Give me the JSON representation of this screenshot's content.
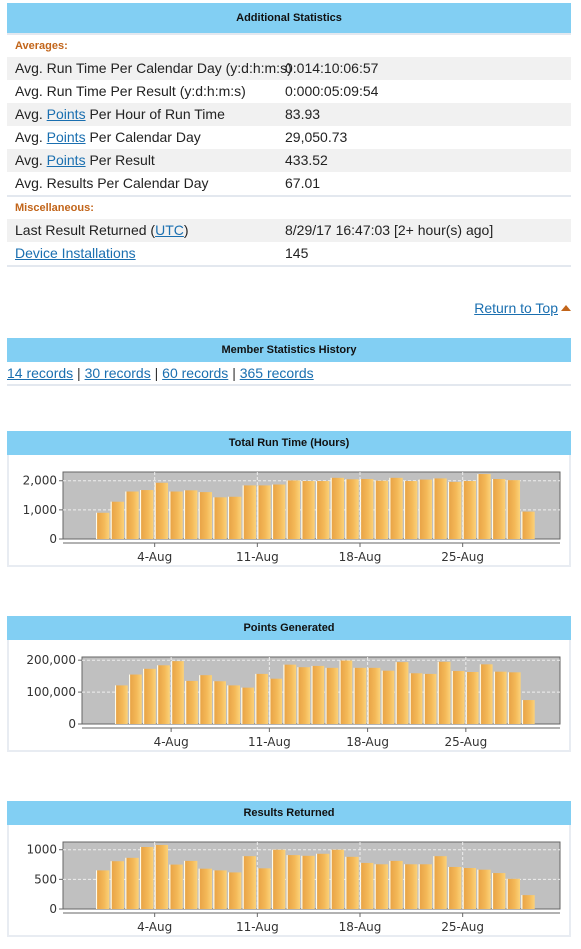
{
  "additional_stats": {
    "title": "Additional Statistics",
    "averages_label": "Averages:",
    "rows": [
      {
        "label": "Avg. Run Time Per Calendar Day (y:d:h:m:s)",
        "value": "0:014:10:06:57"
      },
      {
        "label": "Avg. Run Time Per Result (y:d:h:m:s)",
        "value": "0:000:05:09:54"
      },
      {
        "label_prefix": "Avg. ",
        "link": "Points",
        "label_suffix": " Per Hour of Run Time",
        "value": "83.93"
      },
      {
        "label_prefix": "Avg. ",
        "link": "Points",
        "label_suffix": " Per Calendar Day",
        "value": "29,050.73"
      },
      {
        "label_prefix": "Avg. ",
        "link": "Points",
        "label_suffix": " Per Result",
        "value": "433.52"
      },
      {
        "label": "Avg. Results Per Calendar Day",
        "value": "67.01"
      }
    ],
    "misc_label": "Miscellaneous:",
    "last_result": {
      "label_prefix": "Last Result Returned (",
      "link": "UTC",
      "label_suffix": ")",
      "value": "8/29/17 16:47:03 [2+ hour(s) ago]"
    },
    "device_installations": {
      "link": "Device Installations",
      "value": "145"
    }
  },
  "return_to_top": "Return to Top",
  "history": {
    "title": "Member Statistics History",
    "record_links": [
      "14 records",
      "30 records",
      "60 records",
      "365 records"
    ],
    "separator": " | "
  },
  "colors": {
    "header_bg": "#82cff3",
    "accent_orange": "#c2651a",
    "link": "#1a6fb0",
    "plot_bg": "#c0c0c0",
    "bar": "#f3b552"
  },
  "chart_data": [
    {
      "type": "bar",
      "title": "Total Run Time (Hours)",
      "xlabel": "",
      "ylabel": "",
      "x_ticks": [
        "4-Aug",
        "11-Aug",
        "18-Aug",
        "25-Aug"
      ],
      "x_tick_indices": [
        4,
        11,
        18,
        25
      ],
      "categories": [
        "31-Jul",
        "1-Aug",
        "2-Aug",
        "3-Aug",
        "4-Aug",
        "5-Aug",
        "6-Aug",
        "7-Aug",
        "8-Aug",
        "9-Aug",
        "10-Aug",
        "11-Aug",
        "12-Aug",
        "13-Aug",
        "14-Aug",
        "15-Aug",
        "16-Aug",
        "17-Aug",
        "18-Aug",
        "19-Aug",
        "20-Aug",
        "21-Aug",
        "22-Aug",
        "23-Aug",
        "24-Aug",
        "25-Aug",
        "26-Aug",
        "27-Aug",
        "28-Aug",
        "29-Aug"
      ],
      "values": [
        900,
        1280,
        1630,
        1680,
        1930,
        1630,
        1670,
        1610,
        1430,
        1450,
        1840,
        1840,
        1870,
        2010,
        1990,
        1990,
        2100,
        2050,
        2060,
        2000,
        2100,
        1990,
        2040,
        2080,
        1960,
        1990,
        2230,
        2060,
        2020,
        940
      ],
      "y_ticks": [
        0,
        1000,
        2000
      ],
      "y_tick_labels": [
        "0",
        "1,000",
        "2,000"
      ],
      "ylim": [
        0,
        2300
      ],
      "grid": true
    },
    {
      "type": "bar",
      "title": "Points Generated",
      "xlabel": "",
      "ylabel": "",
      "x_ticks": [
        "4-Aug",
        "11-Aug",
        "18-Aug",
        "25-Aug"
      ],
      "x_tick_indices": [
        4,
        11,
        18,
        25
      ],
      "categories": [
        "31-Jul",
        "1-Aug",
        "2-Aug",
        "3-Aug",
        "4-Aug",
        "5-Aug",
        "6-Aug",
        "7-Aug",
        "8-Aug",
        "9-Aug",
        "10-Aug",
        "11-Aug",
        "12-Aug",
        "13-Aug",
        "14-Aug",
        "15-Aug",
        "16-Aug",
        "17-Aug",
        "18-Aug",
        "19-Aug",
        "20-Aug",
        "21-Aug",
        "22-Aug",
        "23-Aug",
        "24-Aug",
        "25-Aug",
        "26-Aug",
        "27-Aug",
        "28-Aug",
        "29-Aug"
      ],
      "values": [
        121000,
        155000,
        173000,
        184000,
        197000,
        135000,
        153000,
        134000,
        121000,
        114000,
        157000,
        142000,
        186000,
        178000,
        182000,
        176000,
        199000,
        176000,
        176000,
        167000,
        194000,
        159000,
        157000,
        195000,
        166000,
        163000,
        187000,
        164000,
        162000,
        75000
      ],
      "y_ticks": [
        0,
        100000,
        200000
      ],
      "y_tick_labels": [
        "0",
        "100,000",
        "200,000"
      ],
      "ylim": [
        0,
        210000
      ],
      "grid": true
    },
    {
      "type": "bar",
      "title": "Results Returned",
      "xlabel": "",
      "ylabel": "",
      "x_ticks": [
        "4-Aug",
        "11-Aug",
        "18-Aug",
        "25-Aug"
      ],
      "x_tick_indices": [
        4,
        11,
        18,
        25
      ],
      "categories": [
        "31-Jul",
        "1-Aug",
        "2-Aug",
        "3-Aug",
        "4-Aug",
        "5-Aug",
        "6-Aug",
        "7-Aug",
        "8-Aug",
        "9-Aug",
        "10-Aug",
        "11-Aug",
        "12-Aug",
        "13-Aug",
        "14-Aug",
        "15-Aug",
        "16-Aug",
        "17-Aug",
        "18-Aug",
        "19-Aug",
        "20-Aug",
        "21-Aug",
        "22-Aug",
        "23-Aug",
        "24-Aug",
        "25-Aug",
        "26-Aug",
        "27-Aug",
        "28-Aug",
        "29-Aug"
      ],
      "values": [
        651,
        806,
        863,
        1046,
        1080,
        749,
        811,
        680,
        651,
        617,
        891,
        686,
        1000,
        909,
        897,
        931,
        1000,
        880,
        777,
        754,
        811,
        754,
        754,
        891,
        709,
        691,
        663,
        606,
        509,
        234
      ],
      "y_ticks": [
        0,
        500,
        1000
      ],
      "y_tick_labels": [
        "0",
        "500",
        "1000"
      ],
      "ylim": [
        0,
        1130
      ],
      "grid": true
    }
  ]
}
